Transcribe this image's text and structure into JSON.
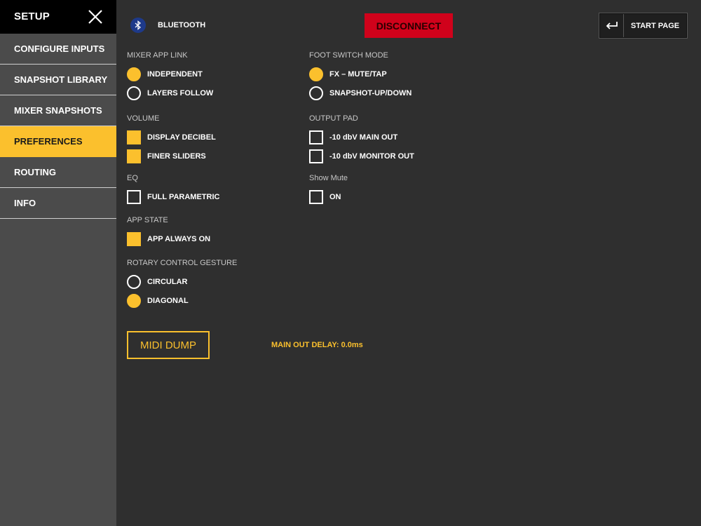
{
  "sidebar": {
    "title": "SETUP",
    "items": [
      {
        "label": "CONFIGURE INPUTS",
        "active": false
      },
      {
        "label": "SNAPSHOT LIBRARY",
        "active": false
      },
      {
        "label": "MIXER SNAPSHOTS",
        "active": false
      },
      {
        "label": "PREFERENCES",
        "active": true
      },
      {
        "label": "ROUTING",
        "active": false
      },
      {
        "label": "INFO",
        "active": false
      }
    ]
  },
  "topbar": {
    "bluetooth_label": "BLUETOOTH",
    "disconnect_label": "DISCONNECT",
    "start_page_label": "START PAGE"
  },
  "preferences": {
    "mixer_app_link": {
      "label": "MIXER APP LINK",
      "options": [
        {
          "label": "INDEPENDENT",
          "selected": true
        },
        {
          "label": "LAYERS FOLLOW",
          "selected": false
        }
      ]
    },
    "volume": {
      "label": "VOLUME",
      "options": [
        {
          "label": "DISPLAY DECIBEL",
          "checked": true
        },
        {
          "label": "FINER SLIDERS",
          "checked": true
        }
      ]
    },
    "eq": {
      "label": "EQ",
      "options": [
        {
          "label": "FULL PARAMETRIC",
          "checked": false
        }
      ]
    },
    "app_state": {
      "label": "APP STATE",
      "options": [
        {
          "label": "APP ALWAYS ON",
          "checked": true
        }
      ]
    },
    "rotary_control_gesture": {
      "label": "ROTARY CONTROL GESTURE",
      "options": [
        {
          "label": "CIRCULAR",
          "selected": false
        },
        {
          "label": "DIAGONAL",
          "selected": true
        }
      ]
    },
    "foot_switch_mode": {
      "label": "FOOT SWITCH MODE",
      "options": [
        {
          "label": "FX – MUTE/TAP",
          "selected": true
        },
        {
          "label": "SNAPSHOT-UP/DOWN",
          "selected": false
        }
      ]
    },
    "output_pad": {
      "label": "OUTPUT PAD",
      "options": [
        {
          "label": "-10 dbV MAIN OUT",
          "checked": false
        },
        {
          "label": "-10 dbV MONITOR OUT",
          "checked": false
        }
      ]
    },
    "show_mute": {
      "label": "Show Mute",
      "options": [
        {
          "label": "ON",
          "checked": false
        }
      ]
    }
  },
  "midi_dump_label": "MIDI DUMP",
  "main_out_delay": "MAIN OUT DELAY: 0.0ms",
  "colors": {
    "accent": "#fbc02d",
    "disconnect": "#d0021b",
    "background": "#2f2f2f",
    "sidebar": "#4b4b4b"
  }
}
